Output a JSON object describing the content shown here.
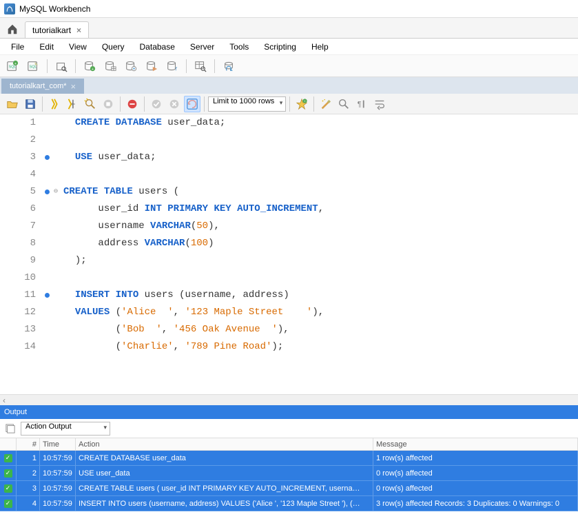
{
  "app": {
    "title": "MySQL Workbench"
  },
  "nav_tab": {
    "label": "tutorialkart",
    "close": "×"
  },
  "menu": [
    "File",
    "Edit",
    "View",
    "Query",
    "Database",
    "Server",
    "Tools",
    "Scripting",
    "Help"
  ],
  "editor_tab": {
    "label": "tutorialkart_com*",
    "close": "×"
  },
  "limit_label": "Limit to 1000 rows",
  "code": {
    "lines": [
      {
        "n": "1",
        "marker": false,
        "fold": "",
        "html": "  <span class='kw'>CREATE</span> <span class='kw'>DATABASE</span> <span class='ident'>user_data</span><span class='punct'>;</span>"
      },
      {
        "n": "2",
        "marker": false,
        "fold": "",
        "html": ""
      },
      {
        "n": "3",
        "marker": true,
        "fold": "",
        "html": "  <span class='kw'>USE</span> <span class='ident'>user_data</span><span class='punct'>;</span>"
      },
      {
        "n": "4",
        "marker": false,
        "fold": "",
        "html": ""
      },
      {
        "n": "5",
        "marker": true,
        "fold": "⊖",
        "html": "<span class='kw'>CREATE</span> <span class='kw'>TABLE</span> <span class='ident'>users</span> <span class='punct'>(</span>"
      },
      {
        "n": "6",
        "marker": false,
        "fold": "",
        "html": "      <span class='ident'>user_id</span> <span class='type'>INT</span> <span class='kw'>PRIMARY KEY</span> <span class='kw'>AUTO_INCREMENT</span><span class='punct'>,</span>"
      },
      {
        "n": "7",
        "marker": false,
        "fold": "",
        "html": "      <span class='ident'>username</span> <span class='type'>VARCHAR</span><span class='punct'>(</span><span class='num'>50</span><span class='punct'>),</span>"
      },
      {
        "n": "8",
        "marker": false,
        "fold": "",
        "html": "      <span class='ident'>address</span> <span class='type'>VARCHAR</span><span class='punct'>(</span><span class='num'>100</span><span class='punct'>)</span>"
      },
      {
        "n": "9",
        "marker": false,
        "fold": "",
        "html": "  <span class='punct'>);</span>"
      },
      {
        "n": "10",
        "marker": false,
        "fold": "",
        "html": ""
      },
      {
        "n": "11",
        "marker": true,
        "fold": "",
        "html": "  <span class='kw'>INSERT</span> <span class='kw'>INTO</span> <span class='ident'>users</span> <span class='punct'>(</span><span class='ident'>username</span><span class='punct'>,</span> <span class='ident'>address</span><span class='punct'>)</span>"
      },
      {
        "n": "12",
        "marker": false,
        "fold": "",
        "html": "  <span class='kw'>VALUES</span> <span class='punct'>(</span><span class='str'>'Alice  '</span><span class='punct'>,</span> <span class='str'>'123 Maple Street    '</span><span class='punct'>),</span>"
      },
      {
        "n": "13",
        "marker": false,
        "fold": "",
        "html": "         <span class='punct'>(</span><span class='str'>'Bob  '</span><span class='punct'>,</span> <span class='str'>'456 Oak Avenue  '</span><span class='punct'>),</span>"
      },
      {
        "n": "14",
        "marker": false,
        "fold": "",
        "html": "         <span class='punct'>(</span><span class='str'>'Charlie'</span><span class='punct'>,</span> <span class='str'>'789 Pine Road'</span><span class='punct'>);</span>"
      }
    ]
  },
  "hscroll_marker": "‹",
  "output": {
    "title": "Output",
    "type_label": "Action Output",
    "columns": {
      "num": "#",
      "time": "Time",
      "action": "Action",
      "message": "Message"
    },
    "rows": [
      {
        "n": "1",
        "time": "10:57:59",
        "action": "CREATE DATABASE user_data",
        "msg": "1 row(s) affected"
      },
      {
        "n": "2",
        "time": "10:57:59",
        "action": "USE user_data",
        "msg": "0 row(s) affected"
      },
      {
        "n": "3",
        "time": "10:57:59",
        "action": "CREATE TABLE users (     user_id INT PRIMARY KEY AUTO_INCREMENT,     userna…",
        "msg": "0 row(s) affected"
      },
      {
        "n": "4",
        "time": "10:57:59",
        "action": "INSERT INTO users (username, address) VALUES ('Alice  ', '123 Maple Street   '),       (…",
        "msg": "3 row(s) affected Records: 3  Duplicates: 0  Warnings: 0"
      }
    ]
  }
}
